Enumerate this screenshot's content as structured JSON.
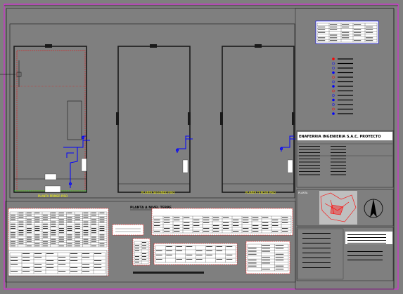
{
  "colors": {
    "background": "#7f7f7f",
    "frame": "#ff00ff",
    "wall": "#1a1a1a",
    "pipe": "#0000ff",
    "hatch": "#ff0000",
    "label": "#ffff00",
    "panel": "#ffffff"
  },
  "plans": [
    {
      "label": "PLANTA PRIMER PISO"
    },
    {
      "label": "PLANTA SEGUNDO PISO"
    },
    {
      "label": "PLANTA TERCER PISO"
    }
  ],
  "detail_title": "PLANTA A NIVEL TERRE",
  "title_block": {
    "company": "ENAFERRIA INGENIERIA S.A.C. PROYECTO",
    "logo_text": "PLANTA"
  },
  "icons": [
    "north-arrow-icon",
    "location-map-icon"
  ]
}
